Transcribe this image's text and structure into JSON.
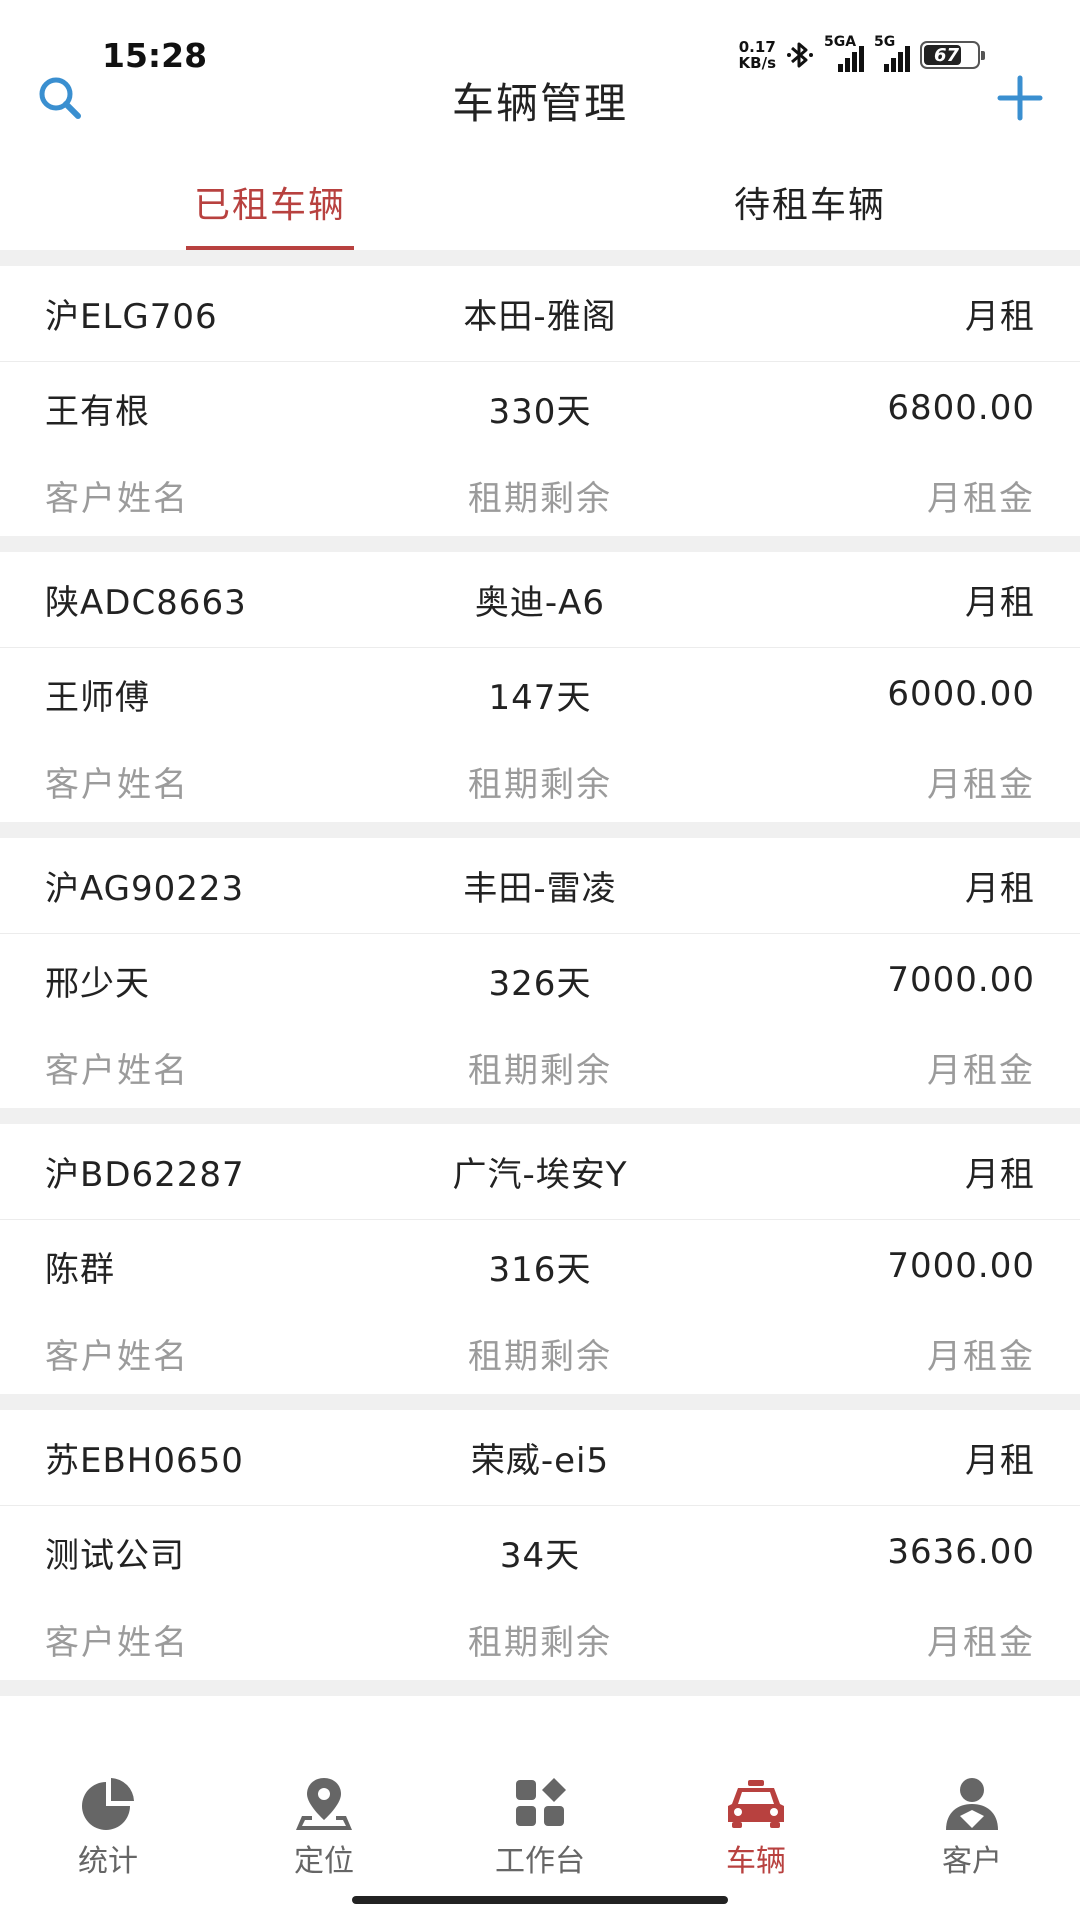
{
  "status_bar": {
    "time": "15:28",
    "net_speed_value": "0.17",
    "net_speed_unit": "KB/s",
    "signal1_label": "5GA",
    "signal2_label": "5G",
    "battery_level": "67"
  },
  "header": {
    "title": "车辆管理",
    "search_icon": "search-icon",
    "add_icon": "plus-icon"
  },
  "tabs": [
    {
      "label": "已租车辆",
      "active": true
    },
    {
      "label": "待租车辆",
      "active": false
    }
  ],
  "labels": {
    "customer_name": "客户姓名",
    "remaining_term": "租期剩余",
    "monthly_rent": "月租金"
  },
  "vehicles": [
    {
      "plate": "沪ELG706",
      "model": "本田-雅阁",
      "rent_type": "月租",
      "customer": "王有根",
      "remaining": "330天",
      "amount": "6800.00"
    },
    {
      "plate": "陕ADC8663",
      "model": "奥迪-A6",
      "rent_type": "月租",
      "customer": "王师傅",
      "remaining": "147天",
      "amount": "6000.00"
    },
    {
      "plate": "沪AG90223",
      "model": "丰田-雷凌",
      "rent_type": "月租",
      "customer": "邢少天",
      "remaining": "326天",
      "amount": "7000.00"
    },
    {
      "plate": "沪BD62287",
      "model": "广汽-埃安Y",
      "rent_type": "月租",
      "customer": "陈群",
      "remaining": "316天",
      "amount": "7000.00"
    },
    {
      "plate": "苏EBH0650",
      "model": "荣威-ei5",
      "rent_type": "月租",
      "customer": "测试公司",
      "remaining": "34天",
      "amount": "3636.00"
    }
  ],
  "bottom_nav": [
    {
      "label": "统计",
      "icon": "pie-chart-icon",
      "active": false
    },
    {
      "label": "定位",
      "icon": "location-pin-icon",
      "active": false
    },
    {
      "label": "工作台",
      "icon": "workbench-grid-icon",
      "active": false
    },
    {
      "label": "车辆",
      "icon": "car-icon",
      "active": true
    },
    {
      "label": "客户",
      "icon": "user-icon",
      "active": false
    }
  ],
  "colors": {
    "accent": "#b8413f",
    "header_icon": "#3a8fd0",
    "caption": "#9b9b9b",
    "nav_inactive": "#666666"
  }
}
